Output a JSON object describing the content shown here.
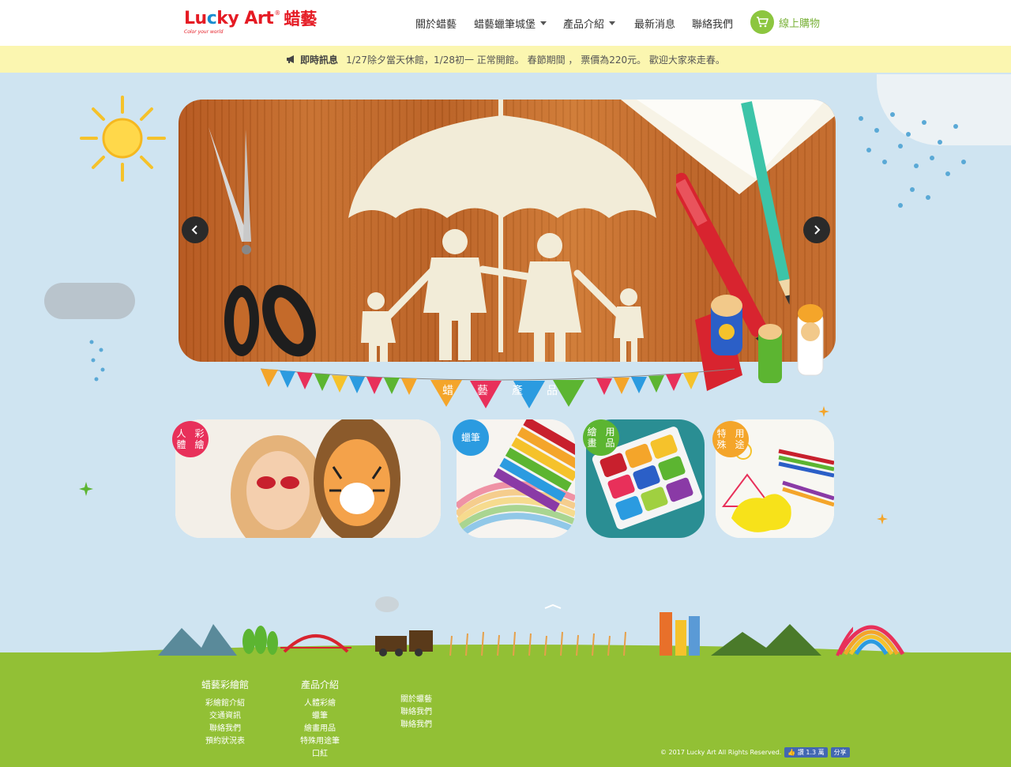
{
  "header": {
    "logo_text_parts": [
      "Lu",
      "c",
      "ky ",
      "Art"
    ],
    "logo_zh": "蜡藝",
    "logo_tag": "Color your world",
    "nav": [
      {
        "label": "關於蜡藝",
        "dropdown": false
      },
      {
        "label": "蜡藝蠟筆城堡",
        "dropdown": true
      },
      {
        "label": "產品介紹",
        "dropdown": true
      },
      {
        "label": "最新消息",
        "dropdown": false
      },
      {
        "label": "聯絡我們",
        "dropdown": false
      }
    ],
    "shop_label": "線上購物",
    "shop_icon": "cart-icon"
  },
  "announcement": {
    "icon": "megaphone-icon",
    "label": "即時訊息",
    "text": "1/27除夕當天休館，1/28初一 正常開館。 春節期間 ， 票價為220元。 歡迎大家來走春。"
  },
  "slider": {
    "prev_icon": "chevron-left-icon",
    "next_icon": "chevron-right-icon"
  },
  "section_title": [
    "蜡",
    "藝",
    "產",
    "品"
  ],
  "products": [
    {
      "badge": "人體\n彩繪",
      "badge_lines": [
        "人體",
        "彩繪"
      ],
      "color": "#e8305a"
    },
    {
      "badge": "蠟筆",
      "badge_lines": [
        "蠟筆"
      ],
      "color": "#2b9be0"
    },
    {
      "badge": "繪畫\n用品",
      "badge_lines": [
        "繪畫",
        "用品"
      ],
      "color": "#5cb531"
    },
    {
      "badge": "特殊\n用途",
      "badge_lines": [
        "特殊",
        "用途"
      ],
      "color": "#f4a52a"
    }
  ],
  "footer": {
    "cols": [
      {
        "head": "蜡藝彩繪館",
        "links": [
          "彩繪館介紹",
          "交通資訊",
          "聯絡我們",
          "預約狀況表"
        ]
      },
      {
        "head": "產品介紹",
        "links": [
          "人體彩繪",
          "蠟筆",
          "繪畫用品",
          "特殊用途筆",
          "口紅"
        ]
      },
      {
        "head": "",
        "links": [
          "關於蠟藝",
          "聯絡我們",
          "聯絡我們"
        ]
      }
    ],
    "copyright": "© 2017 Lucky Art All Rights Reserved.",
    "fb_like": "讚 1.3 萬",
    "fb_share": "分享"
  },
  "colors": {
    "sky": "#cfe4f1",
    "ground": "#92c035",
    "announce_bg": "#fbf6b0",
    "brand_red": "#e51b24",
    "shop_green": "#8cc63f"
  }
}
